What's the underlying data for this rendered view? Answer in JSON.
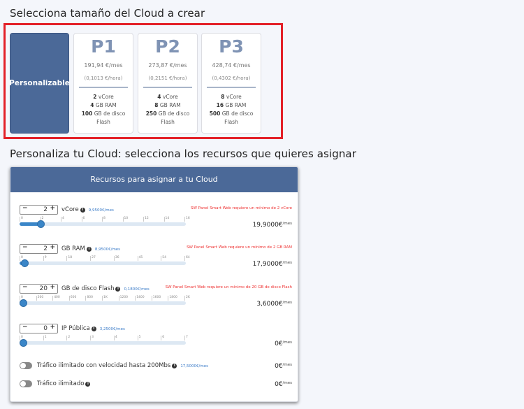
{
  "section1_title": "Selecciona tamaño del Cloud a crear",
  "section2_title": "Personaliza tu Cloud: selecciona los recursos que quieres asignar",
  "custom_plan_label": "Personalizable",
  "plans": [
    {
      "name": "P1",
      "price": "191,94 €/mes",
      "hour": "(0,1013 €/hora)",
      "vcore_n": "2",
      "vcore": "vCore",
      "ram_n": "4",
      "ram": "GB RAM",
      "disk_n": "100",
      "disk": "GB de disco",
      "disk2": "Flash"
    },
    {
      "name": "P2",
      "price": "273,87 €/mes",
      "hour": "(0,2151 €/hora)",
      "vcore_n": "4",
      "vcore": "vCore",
      "ram_n": "8",
      "ram": "GB RAM",
      "disk_n": "250",
      "disk": "GB de disco",
      "disk2": "Flash"
    },
    {
      "name": "P3",
      "price": "428,74 €/mes",
      "hour": "(0,4302 €/hora)",
      "vcore_n": "8",
      "vcore": "vCore",
      "ram_n": "16",
      "ram": "GB RAM",
      "disk_n": "500",
      "disk": "GB de disco",
      "disk2": "Flash"
    }
  ],
  "panel_title": "Recursos para asignar a tu Cloud",
  "resources": [
    {
      "value": "2",
      "label": "vCore",
      "unit_price": "9,9500€/mes",
      "warning": "SW Panel Smart Web requiere un mínimo de 2 vCore",
      "ticks": [
        "0",
        "2",
        "4",
        "6",
        "8",
        "10",
        "12",
        "14",
        "16"
      ],
      "level": 0.125,
      "price": "19,9000€",
      "per": "/mes"
    },
    {
      "value": "2",
      "label": "GB RAM",
      "unit_price": "8,9500€/mes",
      "warning": "SW Panel Smart Web requiere un mínimo de 2 GB RAM",
      "ticks": [
        "0",
        "9",
        "18",
        "27",
        "36",
        "45",
        "54",
        "64"
      ],
      "level": 0.031,
      "price": "17,9000€",
      "per": "/mes"
    },
    {
      "value": "20",
      "label": "GB de disco Flash",
      "unit_price": "0,1800€/mes",
      "warning": "SW Panel Smart Web requiere un mínimo de 20 GB de disco Flash",
      "ticks": [
        "0",
        "200",
        "400",
        "600",
        "800",
        "1K",
        "1200",
        "1400",
        "1600",
        "1800",
        "2K"
      ],
      "level": 0.01,
      "price": "3,6000€",
      "per": "/mes"
    },
    {
      "value": "0",
      "label": "IP Pública",
      "unit_price": "3,2500€/mes",
      "warning": "",
      "ticks": [
        "0",
        "1",
        "2",
        "3",
        "4",
        "5",
        "6",
        "7"
      ],
      "level": 0,
      "price": "0€",
      "per": "/mes"
    }
  ],
  "toggles": [
    {
      "label": "Tráfico ilimitado con velocidad hasta 200Mbs",
      "unit_price": "17,5000€/mes",
      "price": "0€",
      "per": "/mes"
    },
    {
      "label": "Tráfico ilimitado",
      "unit_price": "",
      "price": "0€",
      "per": "/mes"
    }
  ],
  "colors": {
    "accent": "#4b6998",
    "slider": "#3a86c8",
    "warning": "#e33333",
    "highlight": "#e32028"
  }
}
